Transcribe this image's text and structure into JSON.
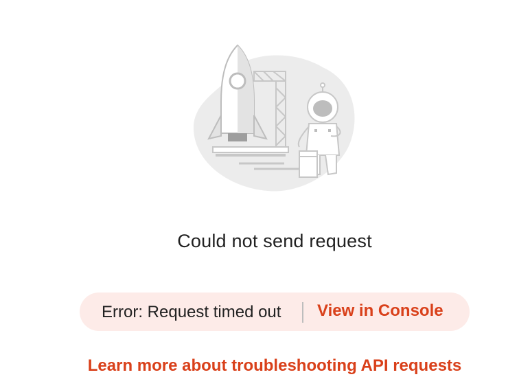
{
  "message": {
    "title": "Could not send request"
  },
  "error": {
    "text": "Error: Request timed out",
    "console_link_label": "View in Console"
  },
  "footer": {
    "learn_more_label": "Learn more about troubleshooting API requests"
  },
  "illustration": {
    "icon": "rocket-launch-astronaut-illustration"
  },
  "colors": {
    "accent": "#d9401a",
    "error_background": "#fdebe8",
    "text": "#212121"
  }
}
